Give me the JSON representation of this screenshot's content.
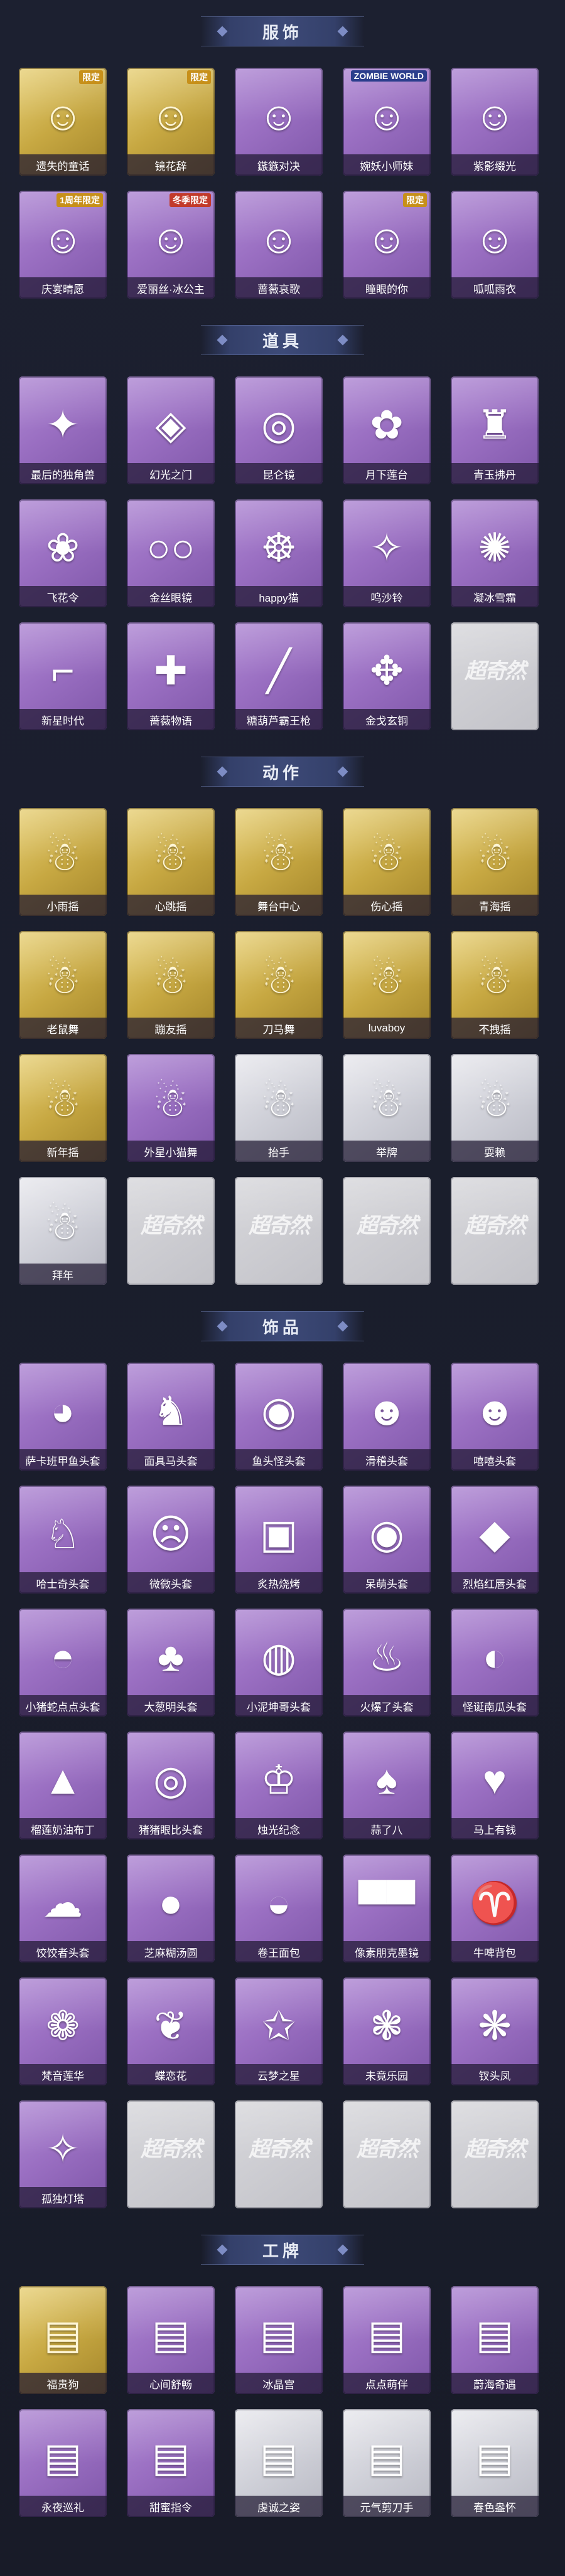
{
  "sections": [
    {
      "title": "服饰",
      "items": [
        {
          "label": "遗失的童话",
          "tier": "gold",
          "icon": "☺",
          "icon_name": "doll-icon",
          "badge": "限定"
        },
        {
          "label": "镜花辞",
          "tier": "gold",
          "icon": "☺",
          "icon_name": "hooded-girl-icon",
          "badge": "限定"
        },
        {
          "label": "鏃鏃对决",
          "tier": "purple",
          "icon": "☺",
          "icon_name": "fighter-icon"
        },
        {
          "label": "婉妖小师妹",
          "tier": "purple",
          "icon": "☺",
          "icon_name": "silver-hair-icon",
          "badge": "ZOMBIE WORLD"
        },
        {
          "label": "紫影缀光",
          "tier": "purple",
          "icon": "☺",
          "icon_name": "mask-girl-icon"
        },
        {
          "label": "庆宴晴愿",
          "tier": "purple",
          "icon": "☺",
          "icon_name": "party-girl-icon",
          "badge": "1周年限定"
        },
        {
          "label": "爱丽丝·冰公主",
          "tier": "purple",
          "icon": "☺",
          "icon_name": "ice-princess-icon",
          "badge": "冬季限定"
        },
        {
          "label": "蔷薇哀歌",
          "tier": "purple",
          "icon": "☺",
          "icon_name": "rose-girl-icon"
        },
        {
          "label": "瞳眼的你",
          "tier": "purple",
          "icon": "☺",
          "icon_name": "hat-girl-icon",
          "badge": "限定"
        },
        {
          "label": "呱呱雨衣",
          "tier": "purple",
          "icon": "☺",
          "icon_name": "frog-hood-icon"
        }
      ]
    },
    {
      "title": "道具",
      "items": [
        {
          "label": "最后的独角兽",
          "tier": "purple",
          "icon": "✦",
          "icon_name": "unicorn-horn-icon"
        },
        {
          "label": "幻光之门",
          "tier": "purple",
          "icon": "◈",
          "icon_name": "gate-icon"
        },
        {
          "label": "昆仑镜",
          "tier": "purple",
          "icon": "◎",
          "icon_name": "mirror-icon"
        },
        {
          "label": "月下莲台",
          "tier": "purple",
          "icon": "✿",
          "icon_name": "lotus-wand-icon"
        },
        {
          "label": "青玉拂丹",
          "tier": "purple",
          "icon": "♜",
          "icon_name": "jade-bottle-icon"
        },
        {
          "label": "飞花令",
          "tier": "purple",
          "icon": "❀",
          "icon_name": "flower-fan-icon"
        },
        {
          "label": "金丝眼镜",
          "tier": "purple",
          "icon": "○○",
          "icon_name": "glasses-icon"
        },
        {
          "label": "happy猫",
          "tier": "purple",
          "icon": "☸",
          "icon_name": "happy-cat-icon"
        },
        {
          "label": "鸣沙铃",
          "tier": "purple",
          "icon": "✧",
          "icon_name": "bell-icon"
        },
        {
          "label": "凝冰雪霜",
          "tier": "purple",
          "icon": "✺",
          "icon_name": "ice-icon"
        },
        {
          "label": "新星时代",
          "tier": "purple",
          "icon": "⌐",
          "icon_name": "pistol-icon"
        },
        {
          "label": "蔷薇物语",
          "tier": "purple",
          "icon": "✚",
          "icon_name": "medkit-icon"
        },
        {
          "label": "糖葫芦霸王枪",
          "tier": "purple",
          "icon": "╱",
          "icon_name": "candy-spear-icon"
        },
        {
          "label": "金戈玄铜",
          "tier": "purple",
          "icon": "✥",
          "icon_name": "grenade-icon"
        },
        {
          "label": "",
          "tier": "empty",
          "icon": "",
          "icon_name": "empty-slot-icon",
          "mark": "超奇然"
        }
      ]
    },
    {
      "title": "动作",
      "items": [
        {
          "label": "小雨摇",
          "tier": "gold",
          "icon": "☃",
          "icon_name": "dance-pose-icon"
        },
        {
          "label": "心跳摇",
          "tier": "gold",
          "icon": "☃",
          "icon_name": "dance-pose-icon"
        },
        {
          "label": "舞台中心",
          "tier": "gold",
          "icon": "☃",
          "icon_name": "dance-pose-icon"
        },
        {
          "label": "伤心摇",
          "tier": "gold",
          "icon": "☃",
          "icon_name": "dance-pose-icon"
        },
        {
          "label": "青海摇",
          "tier": "gold",
          "icon": "☃",
          "icon_name": "dance-pose-icon"
        },
        {
          "label": "老鼠舞",
          "tier": "gold",
          "icon": "☃",
          "icon_name": "dance-pose-icon"
        },
        {
          "label": "蹦友摇",
          "tier": "gold",
          "icon": "☃",
          "icon_name": "dance-pose-icon"
        },
        {
          "label": "刀马舞",
          "tier": "gold",
          "icon": "☃",
          "icon_name": "dance-pose-icon"
        },
        {
          "label": "luvaboy",
          "tier": "gold",
          "icon": "☃",
          "icon_name": "dance-pose-icon"
        },
        {
          "label": "不拽摇",
          "tier": "gold",
          "icon": "☃",
          "icon_name": "dance-pose-icon"
        },
        {
          "label": "新年摇",
          "tier": "gold",
          "icon": "☃",
          "icon_name": "dance-pose-icon"
        },
        {
          "label": "外星小猫舞",
          "tier": "purple",
          "icon": "☃",
          "icon_name": "dance-pose-icon"
        },
        {
          "label": "抬手",
          "tier": "white",
          "icon": "☃",
          "icon_name": "gesture-icon"
        },
        {
          "label": "举牌",
          "tier": "white",
          "icon": "☃",
          "icon_name": "sign-icon"
        },
        {
          "label": "耍赖",
          "tier": "white",
          "icon": "☃",
          "icon_name": "gesture-icon"
        },
        {
          "label": "拜年",
          "tier": "white",
          "icon": "☃",
          "icon_name": "gesture-icon"
        },
        {
          "label": "",
          "tier": "empty",
          "icon": "",
          "icon_name": "empty-slot-icon",
          "mark": "超奇然"
        },
        {
          "label": "",
          "tier": "empty",
          "icon": "",
          "icon_name": "empty-slot-icon",
          "mark": "超奇然"
        },
        {
          "label": "",
          "tier": "empty",
          "icon": "",
          "icon_name": "empty-slot-icon",
          "mark": "超奇然"
        },
        {
          "label": "",
          "tier": "empty",
          "icon": "",
          "icon_name": "empty-slot-icon",
          "mark": "超奇然"
        }
      ]
    },
    {
      "title": "饰品",
      "items": [
        {
          "label": "萨卡班甲鱼头套",
          "tier": "purple",
          "icon": "◕",
          "icon_name": "fish-head-icon"
        },
        {
          "label": "面具马头套",
          "tier": "purple",
          "icon": "♞",
          "icon_name": "horse-head-icon"
        },
        {
          "label": "鱼头怪头套",
          "tier": "purple",
          "icon": "◉",
          "icon_name": "fish-monster-icon"
        },
        {
          "label": "滑稽头套",
          "tier": "purple",
          "icon": "☻",
          "icon_name": "smile-face-icon"
        },
        {
          "label": "嘻嘻头套",
          "tier": "purple",
          "icon": "☻",
          "icon_name": "grin-face-icon"
        },
        {
          "label": "哈士奇头套",
          "tier": "purple",
          "icon": "♘",
          "icon_name": "husky-icon"
        },
        {
          "label": "微微头套",
          "tier": "purple",
          "icon": "☹",
          "icon_name": "shy-face-icon"
        },
        {
          "label": "炙热烧烤",
          "tier": "purple",
          "icon": "▣",
          "icon_name": "toast-icon"
        },
        {
          "label": "呆萌头套",
          "tier": "purple",
          "icon": "◉",
          "icon_name": "wide-eyes-icon"
        },
        {
          "label": "烈焰红唇头套",
          "tier": "purple",
          "icon": "◆",
          "icon_name": "pikachu-icon"
        },
        {
          "label": "小猪蛇点点头套",
          "tier": "purple",
          "icon": "◓",
          "icon_name": "snake-icon"
        },
        {
          "label": "大葱明头套",
          "tier": "purple",
          "icon": "♣",
          "icon_name": "bok-choy-icon"
        },
        {
          "label": "小泥坤哥头套",
          "tier": "purple",
          "icon": "◍",
          "icon_name": "mud-head-icon"
        },
        {
          "label": "火爆了头套",
          "tier": "purple",
          "icon": "♨",
          "icon_name": "fire-head-icon"
        },
        {
          "label": "怪诞南瓜头套",
          "tier": "purple",
          "icon": "◐",
          "icon_name": "pumpkin-icon"
        },
        {
          "label": "榴莲奶油布丁",
          "tier": "purple",
          "icon": "▲",
          "icon_name": "pudding-icon"
        },
        {
          "label": "猪猪眼比头套",
          "tier": "purple",
          "icon": "◎",
          "icon_name": "pig-glasses-icon"
        },
        {
          "label": "烛光纪念",
          "tier": "purple",
          "icon": "♔",
          "icon_name": "candle-icon"
        },
        {
          "label": "蒜了八",
          "tier": "purple",
          "icon": "♠",
          "icon_name": "garlic-icon"
        },
        {
          "label": "马上有钱",
          "tier": "purple",
          "icon": "♥",
          "icon_name": "money-horse-icon"
        },
        {
          "label": "饺饺者头套",
          "tier": "purple",
          "icon": "☁",
          "icon_name": "dumpling-icon"
        },
        {
          "label": "芝麻糊汤圆",
          "tier": "purple",
          "icon": "●",
          "icon_name": "tangyuan-icon"
        },
        {
          "label": "卷王面包",
          "tier": "purple",
          "icon": "◒",
          "icon_name": "bread-icon"
        },
        {
          "label": "像素朋克墨镜",
          "tier": "purple",
          "icon": "▀▀",
          "icon_name": "pixel-sunglasses-icon"
        },
        {
          "label": "牛啤背包",
          "tier": "purple",
          "icon": "♈",
          "icon_name": "cow-backpack-icon"
        },
        {
          "label": "梵音莲华",
          "tier": "purple",
          "icon": "❁",
          "icon_name": "lotus-wings-icon"
        },
        {
          "label": "蝶恋花",
          "tier": "purple",
          "icon": "❦",
          "icon_name": "butterfly-icon"
        },
        {
          "label": "云梦之星",
          "tier": "purple",
          "icon": "✩",
          "icon_name": "cloud-star-icon"
        },
        {
          "label": "未竟乐园",
          "tier": "purple",
          "icon": "❃",
          "icon_name": "paradise-icon"
        },
        {
          "label": "钗头凤",
          "tier": "purple",
          "icon": "❋",
          "icon_name": "hairpin-icon"
        },
        {
          "label": "孤独灯塔",
          "tier": "purple",
          "icon": "✧",
          "icon_name": "lighthouse-icon"
        },
        {
          "label": "",
          "tier": "empty",
          "icon": "",
          "icon_name": "empty-slot-icon",
          "mark": "超奇然"
        },
        {
          "label": "",
          "tier": "empty",
          "icon": "",
          "icon_name": "empty-slot-icon",
          "mark": "超奇然"
        },
        {
          "label": "",
          "tier": "empty",
          "icon": "",
          "icon_name": "empty-slot-icon",
          "mark": "超奇然"
        },
        {
          "label": "",
          "tier": "empty",
          "icon": "",
          "icon_name": "empty-slot-icon",
          "mark": "超奇然"
        }
      ]
    },
    {
      "title": "工牌",
      "items": [
        {
          "label": "福贵狗",
          "tier": "gold",
          "icon": "▤",
          "icon_name": "badge-card-icon"
        },
        {
          "label": "心间舒畅",
          "tier": "purple",
          "icon": "▤",
          "icon_name": "badge-card-icon"
        },
        {
          "label": "冰晶宫",
          "tier": "purple",
          "icon": "▤",
          "icon_name": "badge-card-icon"
        },
        {
          "label": "点点萌伴",
          "tier": "purple",
          "icon": "▤",
          "icon_name": "badge-card-icon"
        },
        {
          "label": "蔚海奇遇",
          "tier": "purple",
          "icon": "▤",
          "icon_name": "badge-card-icon"
        },
        {
          "label": "永夜巡礼",
          "tier": "purple",
          "icon": "▤",
          "icon_name": "badge-card-icon"
        },
        {
          "label": "甜蜜指令",
          "tier": "purple",
          "icon": "▤",
          "icon_name": "badge-card-icon"
        },
        {
          "label": "虔诚之姿",
          "tier": "white",
          "icon": "▤",
          "icon_name": "badge-card-icon"
        },
        {
          "label": "元气剪刀手",
          "tier": "white",
          "icon": "▤",
          "icon_name": "badge-card-icon"
        },
        {
          "label": "春色盎怀",
          "tier": "white",
          "icon": "▤",
          "icon_name": "badge-card-icon"
        }
      ]
    }
  ]
}
